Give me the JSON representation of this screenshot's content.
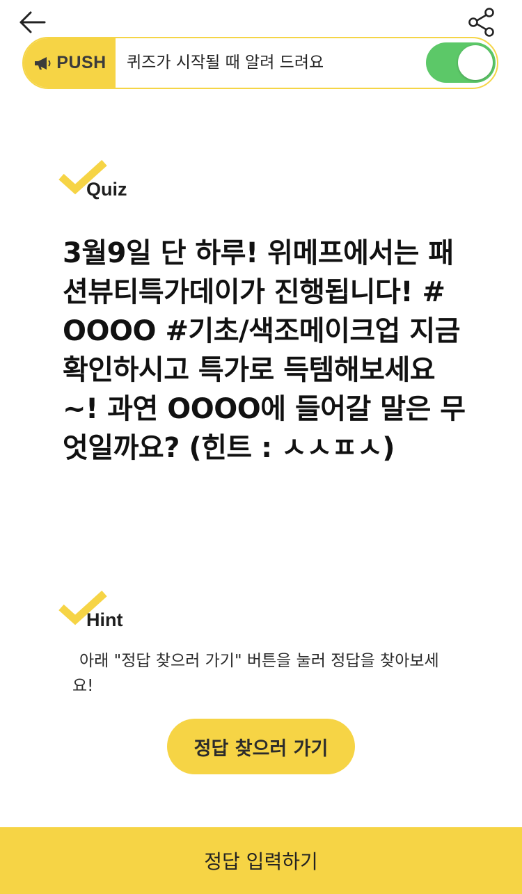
{
  "header": {
    "back_icon": "arrow-left-icon",
    "share_icon": "share-icon"
  },
  "push": {
    "badge_label": "PUSH",
    "badge_icon": "megaphone-icon",
    "message": "퀴즈가 시작될 때 알려 드려요",
    "toggle_on": true,
    "toggle_color": "#5cc868"
  },
  "quiz": {
    "label": "Quiz",
    "question": "3월9일 단 하루! 위메프에서는 패션뷰티특가데이가 진행됩니다! #OOOO #기초/색조메이크업 지금 확인하시고 특가로 득템해보세요~! 과연 OOOO에 들어갈 말은 무엇일까요? (힌트 : ㅅㅅㅍㅅ)"
  },
  "hint": {
    "label": "Hint",
    "text": "아래 \"정답 찾으러 가기\" 버튼을 눌러 정답을 찾아보세요!"
  },
  "buttons": {
    "find_answer": "정답 찾으러 가기",
    "enter_answer": "정답 입력하기"
  },
  "colors": {
    "accent": "#f6d445",
    "check": "#f6d445"
  }
}
